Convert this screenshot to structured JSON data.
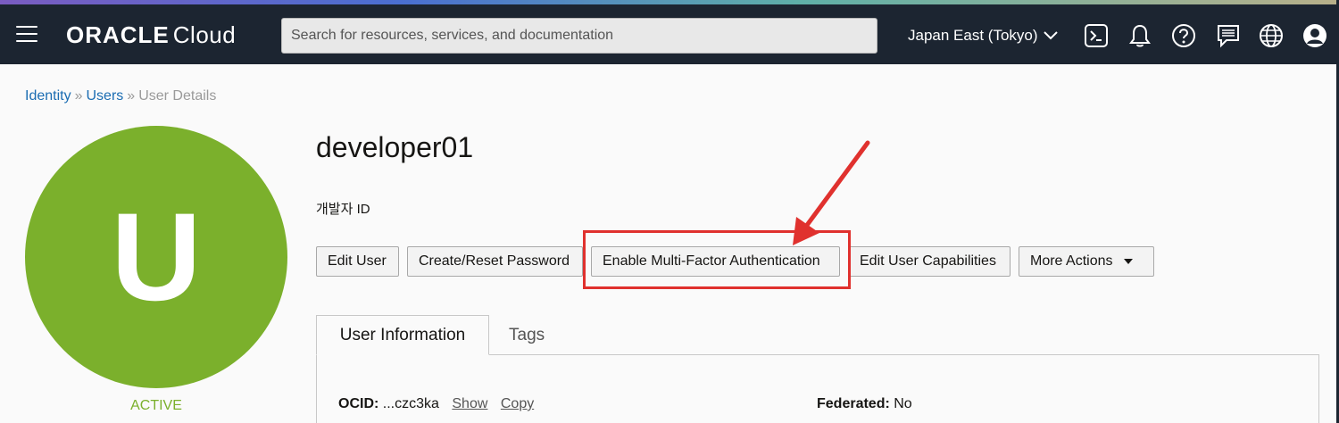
{
  "header": {
    "brand": "ORACLE",
    "product": "Cloud",
    "search_placeholder": "Search for resources, services, and documentation",
    "region": "Japan East (Tokyo)"
  },
  "breadcrumb": {
    "items": [
      "Identity",
      "Users"
    ],
    "current": "User Details",
    "separator": "»"
  },
  "avatar": {
    "letter": "U",
    "color": "#7bb02c"
  },
  "user": {
    "name": "developer01",
    "description": "개발자 ID",
    "status": "ACTIVE"
  },
  "actions": {
    "edit_user": "Edit User",
    "reset_password": "Create/Reset Password",
    "enable_mfa": "Enable Multi-Factor Authentication",
    "edit_capabilities": "Edit User Capabilities",
    "more_actions": "More Actions"
  },
  "tabs": {
    "user_information": "User Information",
    "tags": "Tags"
  },
  "info": {
    "ocid_label": "OCID:",
    "ocid_value": "...czc3ka",
    "show": "Show",
    "copy": "Copy",
    "federated_label": "Federated:",
    "federated_value": "No"
  },
  "icons": [
    "hamburger-menu-icon",
    "cloud-shell-icon",
    "bell-icon",
    "help-icon",
    "feedback-icon",
    "globe-icon",
    "profile-icon"
  ],
  "colors": {
    "topbar": "#1c2531",
    "accent_green": "#7bb02c",
    "link_blue": "#1a6cb2",
    "annotation_red": "#e0312e"
  }
}
